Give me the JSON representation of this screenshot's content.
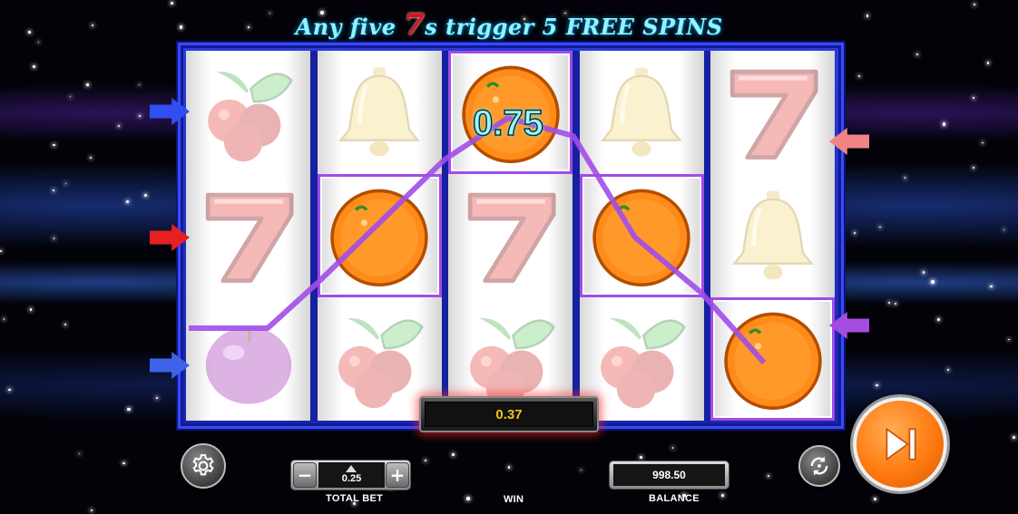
{
  "banner": {
    "prefix": "Any five",
    "seven": "7",
    "suffix": "s trigger 5 FREE SPINS"
  },
  "reels": [
    [
      "cherry",
      "seven",
      "plum"
    ],
    [
      "bell",
      "orange",
      "cherry"
    ],
    [
      "orange",
      "seven",
      "cherry"
    ],
    [
      "bell",
      "orange",
      "cherry"
    ],
    [
      "seven",
      "bell",
      "orange"
    ]
  ],
  "winning_line": {
    "color": "#a14ce8",
    "line_win_value": "0.75"
  },
  "win_display": {
    "value": "0.37"
  },
  "controls": {
    "settings_icon": "gear-icon",
    "bet_minus": "−",
    "bet_plus": "+",
    "total_bet_value": "0.25",
    "total_bet_label": "TOTAL BET",
    "win_label": "WIN",
    "balance_value": "998.50",
    "balance_label": "BALANCE",
    "autoplay_icon": "autoplay-icon",
    "spin_icon": "play-skip-icon"
  },
  "payline_arrows": {
    "left": [
      {
        "color": "#2f4ff0"
      },
      {
        "color": "#e62020"
      },
      {
        "color": "#3f63e8"
      }
    ],
    "right": [
      {
        "color": "#f08484"
      },
      {
        "color": "#a54ce0"
      }
    ]
  }
}
